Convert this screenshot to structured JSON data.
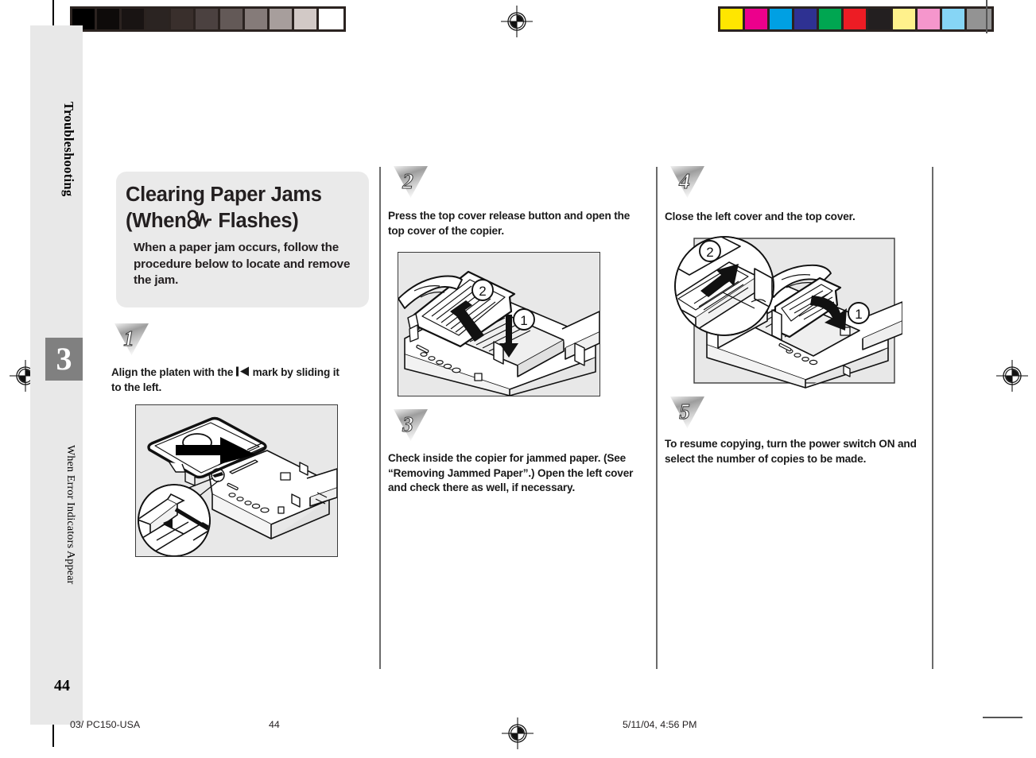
{
  "document": {
    "page_number": "44",
    "chapter_number": "3",
    "chapter_title": "Troubleshooting",
    "section_title": "When Error Indicators Appear"
  },
  "title_panel": {
    "heading_line1": "Clearing Paper Jams",
    "heading_line2_before": "(When",
    "heading_icon": "paper-jam-indicator-icon",
    "heading_line2_after": "Flashes)",
    "intro": "When a paper jam occurs, follow the procedure below to locate and remove the jam."
  },
  "steps": [
    {
      "number": "1",
      "text_before_mark": "Align the platen with the",
      "mark_icon": "align-left-mark-icon",
      "text_after_mark": "mark by sliding it to the left.",
      "figure": "copier-platen-slide-left-illustration",
      "callouts": []
    },
    {
      "number": "2",
      "text": "Press the top cover release button and open the top cover of the copier.",
      "figure": "copier-open-top-cover-illustration",
      "callouts": [
        "1",
        "2"
      ]
    },
    {
      "number": "3",
      "text": "Check inside the copier for jammed paper. (See “Removing Jammed Paper”.) Open the left cover and check there as well, if necessary.",
      "figure": null,
      "callouts": []
    },
    {
      "number": "4",
      "text": "Close the left cover and the top cover.",
      "figure": "copier-close-covers-illustration",
      "callouts": [
        "1",
        "2"
      ]
    },
    {
      "number": "5",
      "text": "To resume copying, turn the power switch ON and select the number of copies to be made.",
      "figure": null,
      "callouts": []
    }
  ],
  "footer": {
    "left": "03/ PC150-USA",
    "center": "44",
    "right": "5/11/04, 4:56 PM"
  },
  "prepress": {
    "grayscale_bar": [
      "#000000",
      "#0e0b0a",
      "#191413",
      "#2b2422",
      "#392f2c",
      "#4b4140",
      "#635957",
      "#857b79",
      "#a79e9c",
      "#d2c9c6",
      "#ffffff"
    ],
    "color_bar": [
      "#ffe600",
      "#ec008c",
      "#00a0e3",
      "#2e3192",
      "#00a651",
      "#ed1c24",
      "#231f20",
      "#fff18c",
      "#f596cc",
      "#86d5f5",
      "#939393"
    ],
    "registration_marks": 4,
    "colors": {
      "sidebar": "#e8e8e8",
      "chapter_box": "#808080",
      "title_panel": "#eaeaea",
      "figure_bg": "#e8e8e8",
      "rule": "#6b6b6b"
    }
  }
}
